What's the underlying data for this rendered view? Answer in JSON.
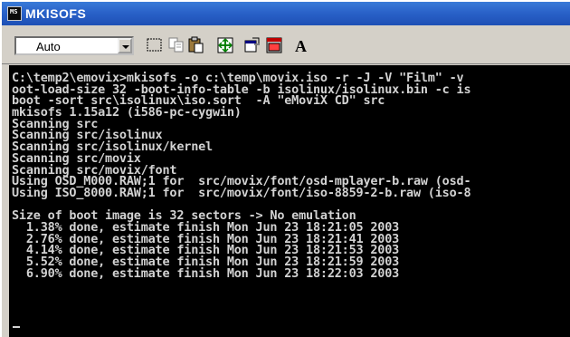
{
  "window": {
    "title": "MKISOFS"
  },
  "toolbar": {
    "font_size_select": {
      "value": "Auto"
    },
    "buttons": [
      {
        "name": "mark-button",
        "icon": "mark-icon"
      },
      {
        "name": "copy-button",
        "icon": "copy-icon"
      },
      {
        "name": "paste-button",
        "icon": "paste-icon"
      },
      {
        "name": "fullscreen-button",
        "icon": "fullscreen-icon"
      },
      {
        "name": "properties-button",
        "icon": "properties-icon"
      },
      {
        "name": "background-button",
        "icon": "background-icon"
      },
      {
        "name": "font-button",
        "icon": "font-icon"
      }
    ]
  },
  "terminal": {
    "lines": [
      "C:\\temp2\\emovix>mkisofs -o c:\\temp\\movix.iso -r -J -V \"Film\" -v",
      "oot-load-size 32 -boot-info-table -b isolinux/isolinux.bin -c is",
      "boot -sort src\\isolinux\\iso.sort  -A \"eMoviX CD\" src",
      "mkisofs 1.15a12 (i586-pc-cygwin)",
      "Scanning src",
      "Scanning src/isolinux",
      "Scanning src/isolinux/kernel",
      "Scanning src/movix",
      "Scanning src/movix/font",
      "Using OSD_M000.RAW;1 for  src/movix/font/osd-mplayer-b.raw (osd-",
      "Using ISO_8000.RAW;1 for  src/movix/font/iso-8859-2-b.raw (iso-8",
      "",
      "Size of boot image is 32 sectors -> No emulation",
      "  1.38% done, estimate finish Mon Jun 23 18:21:05 2003",
      "  2.76% done, estimate finish Mon Jun 23 18:21:41 2003",
      "  4.14% done, estimate finish Mon Jun 23 18:21:53 2003",
      "  5.52% done, estimate finish Mon Jun 23 18:21:59 2003",
      "  6.90% done, estimate finish Mon Jun 23 18:22:03 2003"
    ]
  }
}
